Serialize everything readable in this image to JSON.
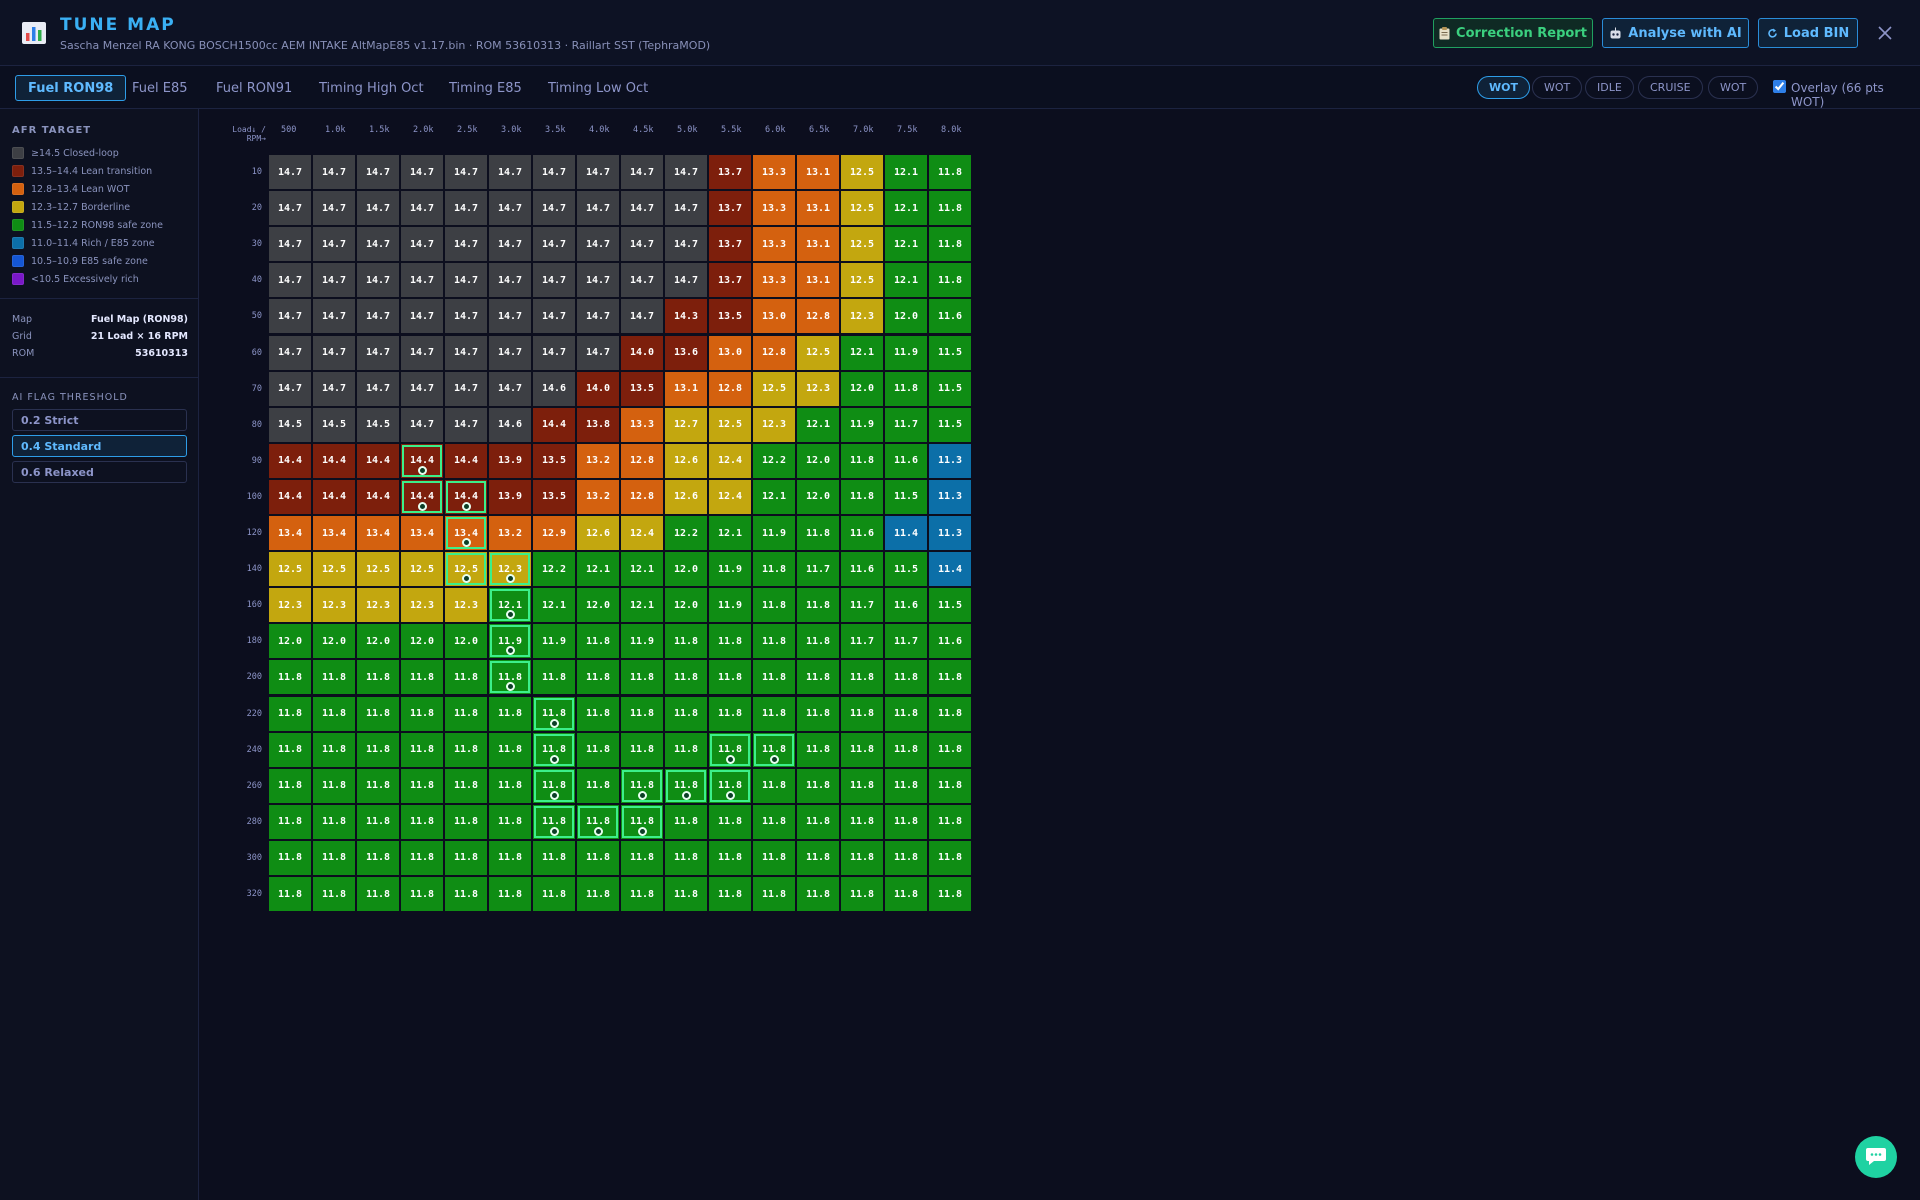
{
  "header": {
    "title": "TUNE MAP",
    "subtitle": "Sascha Menzel RA KONG BOSCH1500cc AEM INTAKE AltMapE85 v1.17.bin · ROM 53610313 · Raillart SST (TephraMOD)",
    "app_icon": "bar-chart-icon",
    "buttons": {
      "correction_report": "Correction Report",
      "analyse_ai": "Analyse with AI",
      "load_bin": "Load BIN"
    },
    "colors": {
      "accent": "#3ab0f4",
      "green": "#3bd07f"
    }
  },
  "tabs": [
    "Fuel RON98",
    "Fuel E85",
    "Fuel RON91",
    "Timing High Oct",
    "Timing E85",
    "Timing Low Oct"
  ],
  "active_tab": "Fuel RON98",
  "modes": [
    "WOT",
    "WOT",
    "IDLE",
    "CRUISE",
    "WOT"
  ],
  "active_mode_index": 0,
  "overlay": {
    "checked": true,
    "label": "Overlay (66 pts WOT)"
  },
  "sidebar": {
    "afr_heading": "AFR TARGET",
    "legend": [
      {
        "label": "≥14.5 Closed-loop",
        "color": "#3d3f44"
      },
      {
        "label": "13.5–14.4 Lean transition",
        "color": "#7d1f0c"
      },
      {
        "label": "12.8–13.4 Lean WOT",
        "color": "#d4610f"
      },
      {
        "label": "12.3–12.7 Borderline",
        "color": "#c3a70f"
      },
      {
        "label": "11.5–12.2 RON98 safe zone",
        "color": "#0f8d14"
      },
      {
        "label": "11.0–11.4 Rich / E85 zone",
        "color": "#0c6fa8"
      },
      {
        "label": "10.5–10.9 E85 safe zone",
        "color": "#1456d4"
      },
      {
        "label": "<10.5 Excessively rich",
        "color": "#7a18c8"
      }
    ],
    "info": [
      {
        "key": "Map",
        "value": "Fuel Map (RON98)"
      },
      {
        "key": "Grid",
        "value": "21 Load × 16 RPM"
      },
      {
        "key": "ROM",
        "value": "53610313"
      }
    ],
    "threshold_heading": "AI FLAG THRESHOLD",
    "thresholds": [
      "0.2 Strict",
      "0.4 Standard",
      "0.6 Relaxed"
    ],
    "active_threshold": 1
  },
  "grid": {
    "corner_label": [
      "Load↓ /",
      "RPM→"
    ],
    "rpm": [
      "500",
      "1.0k",
      "1.5k",
      "2.0k",
      "2.5k",
      "3.0k",
      "3.5k",
      "4.0k",
      "4.5k",
      "5.0k",
      "5.5k",
      "6.0k",
      "6.5k",
      "7.0k",
      "7.5k",
      "8.0k"
    ],
    "load": [
      "10",
      "20",
      "30",
      "40",
      "50",
      "60",
      "70",
      "80",
      "90",
      "100",
      "120",
      "140",
      "160",
      "180",
      "200",
      "220",
      "240",
      "260",
      "280",
      "300",
      "320"
    ],
    "values": [
      [
        14.7,
        14.7,
        14.7,
        14.7,
        14.7,
        14.7,
        14.7,
        14.7,
        14.7,
        14.7,
        13.7,
        13.3,
        13.1,
        12.5,
        12.1,
        11.8
      ],
      [
        14.7,
        14.7,
        14.7,
        14.7,
        14.7,
        14.7,
        14.7,
        14.7,
        14.7,
        14.7,
        13.7,
        13.3,
        13.1,
        12.5,
        12.1,
        11.8
      ],
      [
        14.7,
        14.7,
        14.7,
        14.7,
        14.7,
        14.7,
        14.7,
        14.7,
        14.7,
        14.7,
        13.7,
        13.3,
        13.1,
        12.5,
        12.1,
        11.8
      ],
      [
        14.7,
        14.7,
        14.7,
        14.7,
        14.7,
        14.7,
        14.7,
        14.7,
        14.7,
        14.7,
        13.7,
        13.3,
        13.1,
        12.5,
        12.1,
        11.8
      ],
      [
        14.7,
        14.7,
        14.7,
        14.7,
        14.7,
        14.7,
        14.7,
        14.7,
        14.7,
        14.3,
        13.5,
        13.0,
        12.8,
        12.3,
        12.0,
        11.6
      ],
      [
        14.7,
        14.7,
        14.7,
        14.7,
        14.7,
        14.7,
        14.7,
        14.7,
        14.0,
        13.6,
        13.0,
        12.8,
        12.5,
        12.1,
        11.9,
        11.5
      ],
      [
        14.7,
        14.7,
        14.7,
        14.7,
        14.7,
        14.7,
        14.6,
        14.0,
        13.5,
        13.1,
        12.8,
        12.5,
        12.3,
        12.0,
        11.8,
        11.5
      ],
      [
        14.5,
        14.5,
        14.5,
        14.7,
        14.7,
        14.6,
        14.4,
        13.8,
        13.3,
        12.7,
        12.5,
        12.3,
        12.1,
        11.9,
        11.7,
        11.5
      ],
      [
        14.4,
        14.4,
        14.4,
        14.4,
        14.4,
        13.9,
        13.5,
        13.2,
        12.8,
        12.6,
        12.4,
        12.2,
        12.0,
        11.8,
        11.6,
        11.3
      ],
      [
        14.4,
        14.4,
        14.4,
        14.4,
        14.4,
        13.9,
        13.5,
        13.2,
        12.8,
        12.6,
        12.4,
        12.1,
        12.0,
        11.8,
        11.5,
        11.3
      ],
      [
        13.4,
        13.4,
        13.4,
        13.4,
        13.4,
        13.2,
        12.9,
        12.6,
        12.4,
        12.2,
        12.1,
        11.9,
        11.8,
        11.6,
        11.4,
        11.3
      ],
      [
        12.5,
        12.5,
        12.5,
        12.5,
        12.5,
        12.3,
        12.2,
        12.1,
        12.1,
        12.0,
        11.9,
        11.8,
        11.7,
        11.6,
        11.5,
        11.4
      ],
      [
        12.3,
        12.3,
        12.3,
        12.3,
        12.3,
        12.1,
        12.1,
        12.0,
        12.1,
        12.0,
        11.9,
        11.8,
        11.8,
        11.7,
        11.6,
        11.5
      ],
      [
        12.0,
        12.0,
        12.0,
        12.0,
        12.0,
        11.9,
        11.9,
        11.8,
        11.9,
        11.8,
        11.8,
        11.8,
        11.8,
        11.7,
        11.7,
        11.6
      ],
      [
        11.8,
        11.8,
        11.8,
        11.8,
        11.8,
        11.8,
        11.8,
        11.8,
        11.8,
        11.8,
        11.8,
        11.8,
        11.8,
        11.8,
        11.8,
        11.8
      ],
      [
        11.8,
        11.8,
        11.8,
        11.8,
        11.8,
        11.8,
        11.8,
        11.8,
        11.8,
        11.8,
        11.8,
        11.8,
        11.8,
        11.8,
        11.8,
        11.8
      ],
      [
        11.8,
        11.8,
        11.8,
        11.8,
        11.8,
        11.8,
        11.8,
        11.8,
        11.8,
        11.8,
        11.8,
        11.8,
        11.8,
        11.8,
        11.8,
        11.8
      ],
      [
        11.8,
        11.8,
        11.8,
        11.8,
        11.8,
        11.8,
        11.8,
        11.8,
        11.8,
        11.8,
        11.8,
        11.8,
        11.8,
        11.8,
        11.8,
        11.8
      ],
      [
        11.8,
        11.8,
        11.8,
        11.8,
        11.8,
        11.8,
        11.8,
        11.8,
        11.8,
        11.8,
        11.8,
        11.8,
        11.8,
        11.8,
        11.8,
        11.8
      ],
      [
        11.8,
        11.8,
        11.8,
        11.8,
        11.8,
        11.8,
        11.8,
        11.8,
        11.8,
        11.8,
        11.8,
        11.8,
        11.8,
        11.8,
        11.8,
        11.8
      ],
      [
        11.8,
        11.8,
        11.8,
        11.8,
        11.8,
        11.8,
        11.8,
        11.8,
        11.8,
        11.8,
        11.8,
        11.8,
        11.8,
        11.8,
        11.8,
        11.8
      ]
    ],
    "flagged_cells": [
      [
        "90",
        "2.0k"
      ],
      [
        "100",
        "2.0k"
      ],
      [
        "100",
        "2.5k"
      ],
      [
        "120",
        "2.5k"
      ],
      [
        "140",
        "2.5k"
      ],
      [
        "140",
        "3.0k"
      ],
      [
        "160",
        "3.0k"
      ],
      [
        "180",
        "3.0k"
      ],
      [
        "200",
        "3.0k"
      ],
      [
        "220",
        "3.5k"
      ],
      [
        "240",
        "3.5k"
      ],
      [
        "240",
        "5.5k"
      ],
      [
        "240",
        "6.0k"
      ],
      [
        "260",
        "3.5k"
      ],
      [
        "260",
        "4.5k"
      ],
      [
        "260",
        "5.0k"
      ],
      [
        "260",
        "5.5k"
      ],
      [
        "280",
        "3.5k"
      ],
      [
        "280",
        "4.0k"
      ],
      [
        "280",
        "4.5k"
      ]
    ]
  },
  "chat_button_icon": "chat-bubble-icon"
}
